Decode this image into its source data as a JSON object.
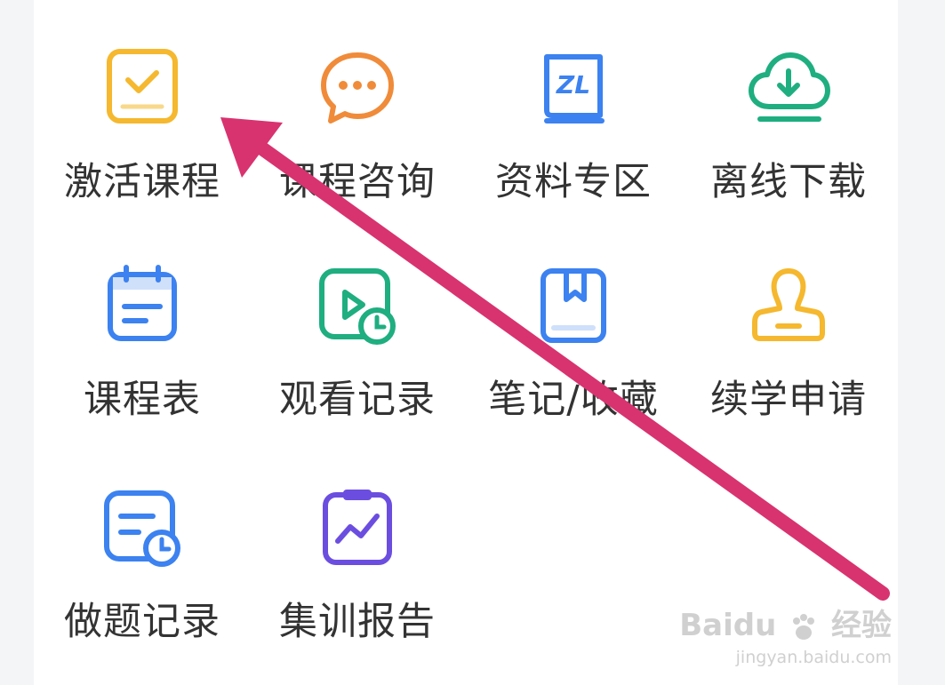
{
  "menu": {
    "items": [
      {
        "label": "激活课程",
        "icon": "activate-course-icon",
        "color": "#f5b82e"
      },
      {
        "label": "课程咨询",
        "icon": "chat-bubble-icon",
        "color": "#f08b3a"
      },
      {
        "label": "资料专区",
        "icon": "book-icon",
        "color": "#3c82f0"
      },
      {
        "label": "离线下载",
        "icon": "cloud-download-icon",
        "color": "#1fae80"
      },
      {
        "label": "课程表",
        "icon": "calendar-icon",
        "color": "#3c82f0"
      },
      {
        "label": "观看记录",
        "icon": "video-history-icon",
        "color": "#1fae80"
      },
      {
        "label": "笔记/收藏",
        "icon": "bookmark-book-icon",
        "color": "#3c82f0"
      },
      {
        "label": "续学申请",
        "icon": "stamp-icon",
        "color": "#f5b82e"
      },
      {
        "label": "做题记录",
        "icon": "exercise-history-icon",
        "color": "#3c82f0"
      },
      {
        "label": "集训报告",
        "icon": "report-chart-icon",
        "color": "#6b4ee0"
      }
    ]
  },
  "annotation": {
    "arrow_color": "#d8336f"
  },
  "watermark": {
    "brand": "Baidu",
    "brand_cn": "经验",
    "url": "jingyan.baidu.com"
  }
}
